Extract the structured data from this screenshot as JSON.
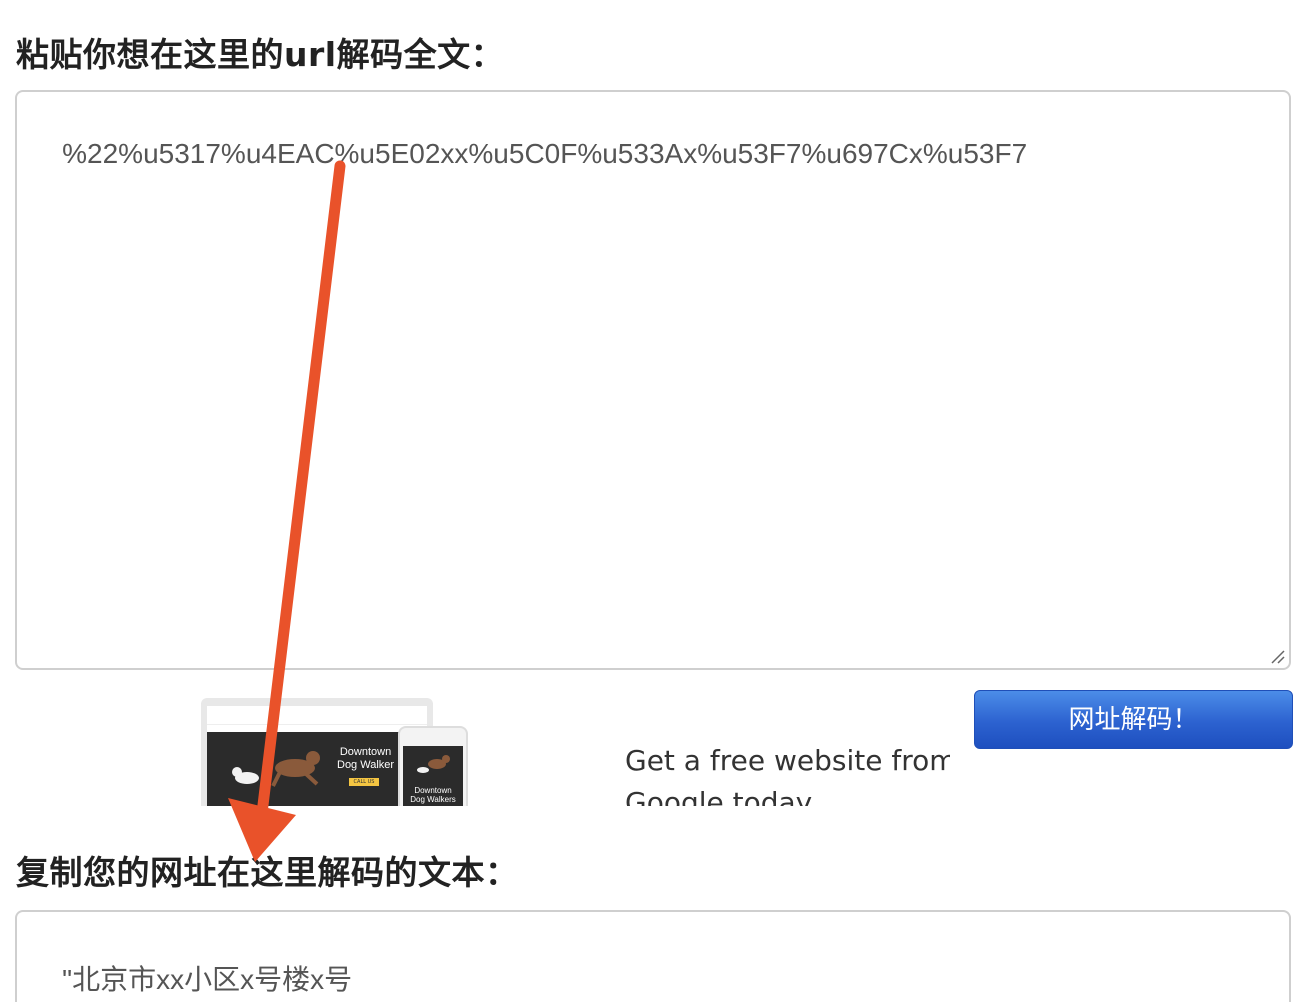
{
  "input_section": {
    "label": "粘贴你想在这里的url解码全文：",
    "text": "%22%u5317%u4EAC%u5E02xx%u5C0F%u533Ax%u53F7%u697Cx%u53F7"
  },
  "ad": {
    "laptop_title": "Downtown\nDog Walker",
    "call_label": "CALL US",
    "phone_title": "Downtown\nDog Walkers",
    "headline": "Get a free website from\nGoogle today"
  },
  "decode_button": {
    "label": "网址解码！"
  },
  "output_section": {
    "label": "复制您的网址在这里解码的文本：",
    "text": "\"北京市xx小区x号楼x号"
  },
  "annotation": {
    "arrow_color": "#e9522a"
  }
}
